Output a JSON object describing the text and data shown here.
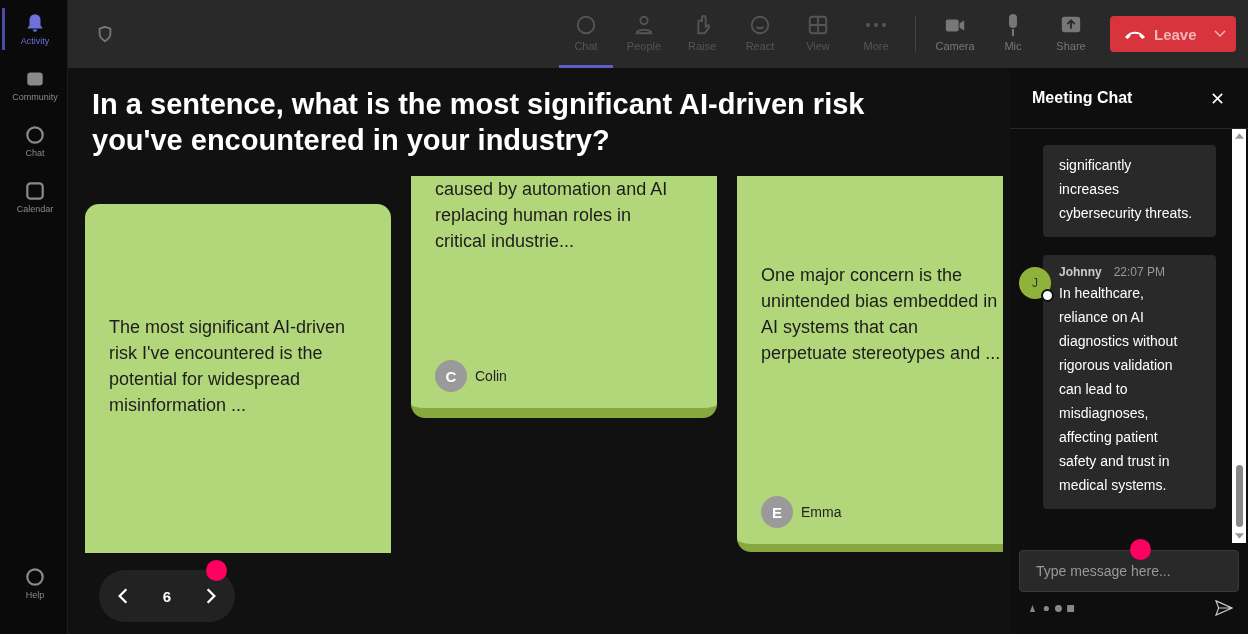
{
  "sidebar": {
    "items": [
      {
        "label": "Activity",
        "selected": true
      },
      {
        "label": "Community",
        "selected": false
      },
      {
        "label": "Chat",
        "selected": false
      },
      {
        "label": "Calendar",
        "selected": false
      }
    ],
    "help": "Help"
  },
  "toolbar": {
    "items": [
      {
        "label": "Chat",
        "selected": true
      },
      {
        "label": "People",
        "selected": false
      },
      {
        "label": "Raise",
        "selected": false
      },
      {
        "label": "React",
        "selected": false
      },
      {
        "label": "View",
        "selected": false
      },
      {
        "label": "More",
        "selected": false
      }
    ],
    "devices": [
      "Camera",
      "Mic",
      "Share"
    ],
    "leave": "Leave"
  },
  "question": "In a sentence, what is the most significant AI-driven risk you've encountered in your industry?",
  "cards": [
    {
      "text": "The most significant AI-driven risk I've encountered is the potential for widespread misinformation ..."
    },
    {
      "text": "caused by automation and AI replacing human roles in critical industrie...",
      "author": "Colin",
      "initial": "C"
    },
    {
      "text": "One major concern is the unintended bias embedded in AI systems that can perpetuate stereotypes and ...",
      "author": "Emma",
      "initial": "E"
    }
  ],
  "pager": {
    "page": "6"
  },
  "chat": {
    "title": "Meeting Chat",
    "messages": [
      {
        "text": "significantly increases cybersecurity threats."
      },
      {
        "author": "Johnny",
        "initial": "J",
        "time": "22:07 PM",
        "text": "In healthcare, reliance on AI diagnostics without rigorous validation can lead to misdiagnoses, affecting patient safety and trust in medical systems."
      }
    ],
    "placeholder": "Type message here..."
  }
}
